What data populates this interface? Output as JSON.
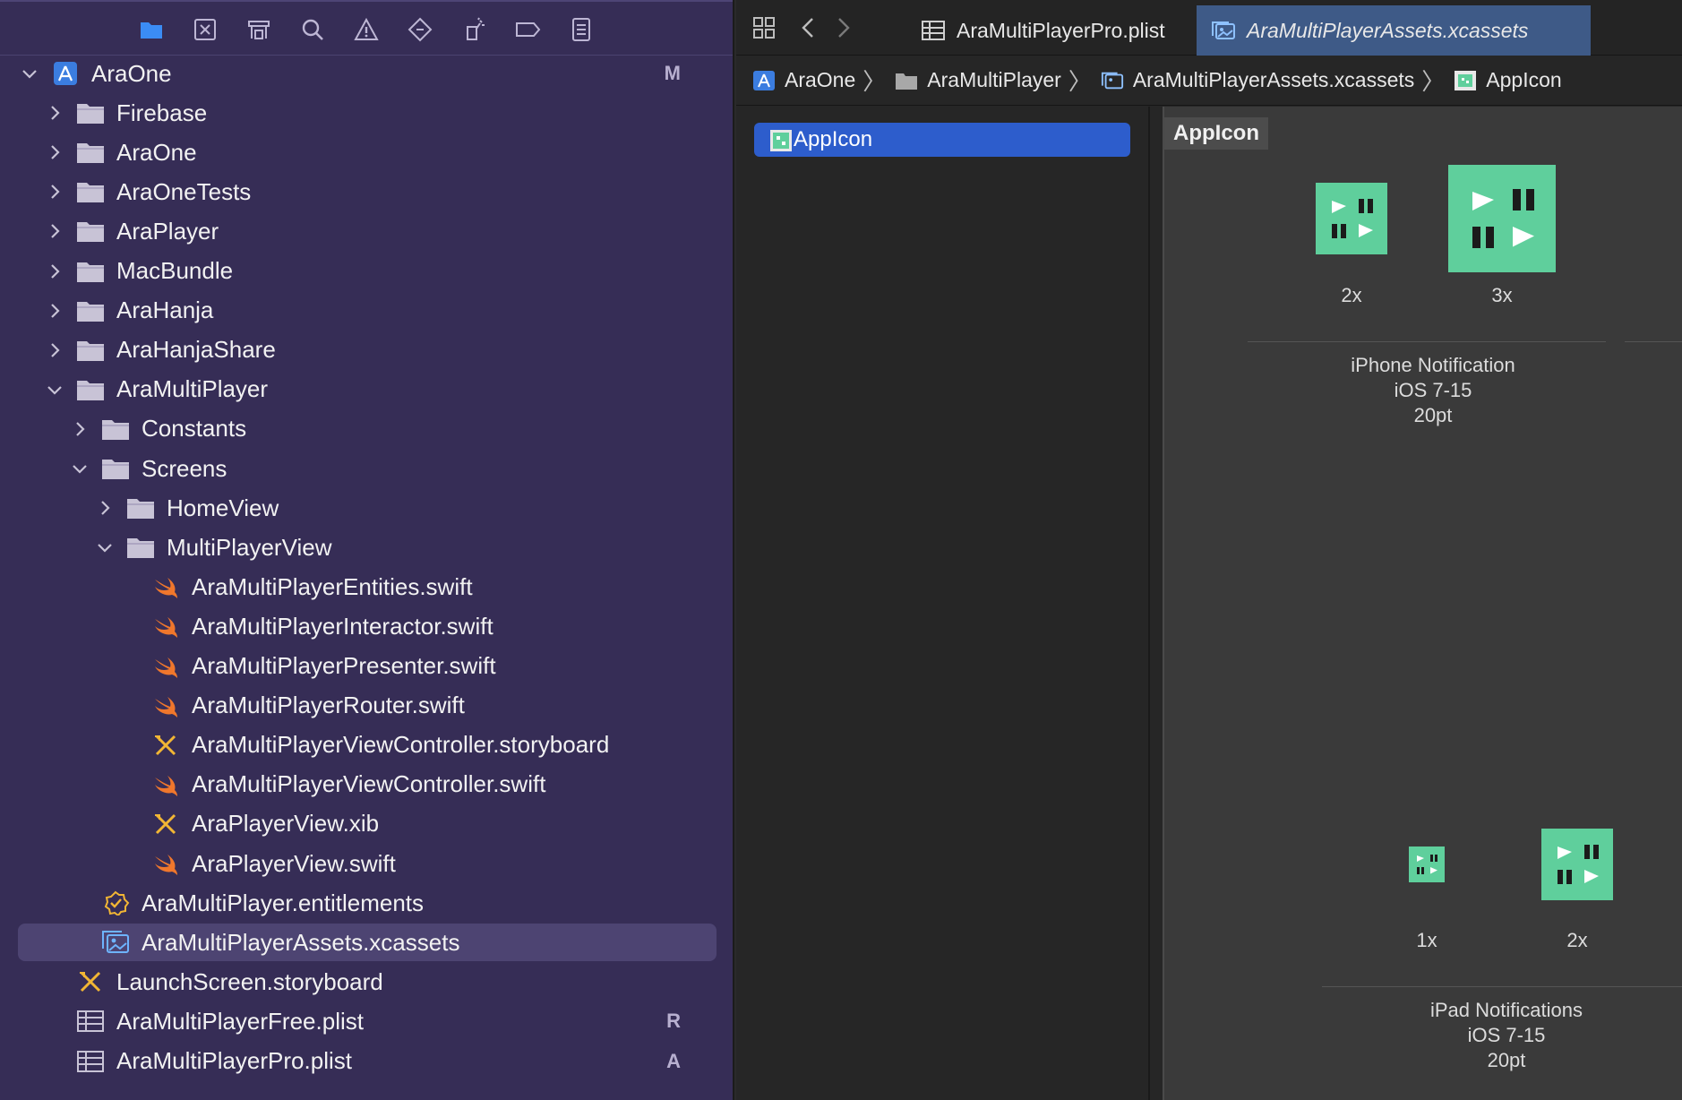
{
  "navigator": {
    "toolbar_icons": [
      "folder-icon",
      "source-control-icon",
      "symbol-navigator-icon",
      "search-icon",
      "warning-icon",
      "test-icon",
      "debug-icon",
      "breakpoint-icon",
      "report-icon"
    ],
    "tree": [
      {
        "label": "AraOne",
        "kind": "project",
        "chevron": "down",
        "badge": "M"
      },
      {
        "label": "Firebase",
        "kind": "folder",
        "chevron": "right",
        "badge": ""
      },
      {
        "label": "AraOne",
        "kind": "folder",
        "chevron": "right",
        "badge": ""
      },
      {
        "label": "AraOneTests",
        "kind": "folder",
        "chevron": "right",
        "badge": ""
      },
      {
        "label": "AraPlayer",
        "kind": "folder",
        "chevron": "right",
        "badge": ""
      },
      {
        "label": "MacBundle",
        "kind": "folder",
        "chevron": "right",
        "badge": ""
      },
      {
        "label": "AraHanja",
        "kind": "folder",
        "chevron": "right",
        "badge": ""
      },
      {
        "label": "AraHanjaShare",
        "kind": "folder",
        "chevron": "right",
        "badge": ""
      },
      {
        "label": "AraMultiPlayer",
        "kind": "folder",
        "chevron": "down",
        "badge": ""
      },
      {
        "label": "Constants",
        "kind": "folder",
        "chevron": "right",
        "badge": ""
      },
      {
        "label": "Screens",
        "kind": "folder",
        "chevron": "down",
        "badge": ""
      },
      {
        "label": "HomeView",
        "kind": "folder",
        "chevron": "right",
        "badge": ""
      },
      {
        "label": "MultiPlayerView",
        "kind": "folder",
        "chevron": "down",
        "badge": ""
      },
      {
        "label": "AraMultiPlayerEntities.swift",
        "kind": "swift",
        "chevron": "",
        "badge": ""
      },
      {
        "label": "AraMultiPlayerInteractor.swift",
        "kind": "swift",
        "chevron": "",
        "badge": ""
      },
      {
        "label": "AraMultiPlayerPresenter.swift",
        "kind": "swift",
        "chevron": "",
        "badge": ""
      },
      {
        "label": "AraMultiPlayerRouter.swift",
        "kind": "swift",
        "chevron": "",
        "badge": ""
      },
      {
        "label": "AraMultiPlayerViewController.storyboard",
        "kind": "storyboard",
        "chevron": "",
        "badge": ""
      },
      {
        "label": "AraMultiPlayerViewController.swift",
        "kind": "swift",
        "chevron": "",
        "badge": ""
      },
      {
        "label": "AraPlayerView.xib",
        "kind": "storyboard",
        "chevron": "",
        "badge": ""
      },
      {
        "label": "AraPlayerView.swift",
        "kind": "swift",
        "chevron": "",
        "badge": ""
      },
      {
        "label": "AraMultiPlayer.entitlements",
        "kind": "entitlements",
        "chevron": "",
        "badge": ""
      },
      {
        "label": "AraMultiPlayerAssets.xcassets",
        "kind": "xcassets",
        "chevron": "",
        "badge": "",
        "selected": true
      },
      {
        "label": "LaunchScreen.storyboard",
        "kind": "storyboard",
        "chevron": "",
        "badge": ""
      },
      {
        "label": "AraMultiPlayerFree.plist",
        "kind": "plist",
        "chevron": "",
        "badge": "R"
      },
      {
        "label": "AraMultiPlayerPro.plist",
        "kind": "plist",
        "chevron": "",
        "badge": "A"
      }
    ]
  },
  "editor": {
    "tabs": [
      {
        "label": "AraMultiPlayerPro.plist",
        "icon": "plist-icon",
        "active": false
      },
      {
        "label": "AraMultiPlayerAssets.xcassets",
        "icon": "xcassets-icon",
        "active": true
      }
    ],
    "breadcrumb": [
      {
        "label": "AraOne",
        "icon": "project-icon"
      },
      {
        "label": "AraMultiPlayer",
        "icon": "folder-icon"
      },
      {
        "label": "AraMultiPlayerAssets.xcassets",
        "icon": "xcassets-icon"
      },
      {
        "label": "AppIcon",
        "icon": "appicon-icon"
      }
    ],
    "asset_list": [
      {
        "label": "AppIcon"
      }
    ],
    "detail": {
      "title": "AppIcon",
      "groups": [
        {
          "slots": [
            {
              "scale": "2x"
            },
            {
              "scale": "3x"
            }
          ],
          "caption": [
            "iPhone Notification",
            "iOS 7-15",
            "20pt"
          ]
        },
        {
          "slots": [
            {
              "scale": "1x"
            },
            {
              "scale": "2x"
            }
          ],
          "caption": [
            "iPad Notifications",
            "iOS 7-15",
            "20pt"
          ]
        }
      ]
    }
  },
  "colors": {
    "navigator_bg": "#362d56",
    "selection": "#4d4472",
    "accent_blue": "#2d5dcc",
    "icon_green": "#5fcf9c",
    "swift_orange": "#f0772c",
    "folder_gray": "#c8c3d6"
  }
}
